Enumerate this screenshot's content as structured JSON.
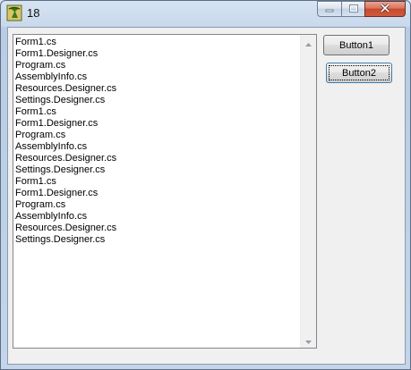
{
  "window": {
    "title": "18"
  },
  "icons": {
    "app": "app-icon",
    "minimize": "minimize-icon",
    "maximize": "maximize-icon",
    "close": "close-icon",
    "scroll_up": "scroll-up-arrow-icon",
    "scroll_down": "scroll-down-arrow-icon"
  },
  "listbox": {
    "items": [
      "Form1.cs",
      "Form1.Designer.cs",
      "Program.cs",
      "AssemblyInfo.cs",
      "Resources.Designer.cs",
      "Settings.Designer.cs",
      "Form1.cs",
      "Form1.Designer.cs",
      "Program.cs",
      "AssemblyInfo.cs",
      "Resources.Designer.cs",
      "Settings.Designer.cs",
      "Form1.cs",
      "Form1.Designer.cs",
      "Program.cs",
      "AssemblyInfo.cs",
      "Resources.Designer.cs",
      "Settings.Designer.cs"
    ]
  },
  "buttons": {
    "button1_label": "Button1",
    "button2_label": "Button2"
  },
  "colors": {
    "close_button": "#c74a2f",
    "focus_border": "#3c7fb1"
  }
}
